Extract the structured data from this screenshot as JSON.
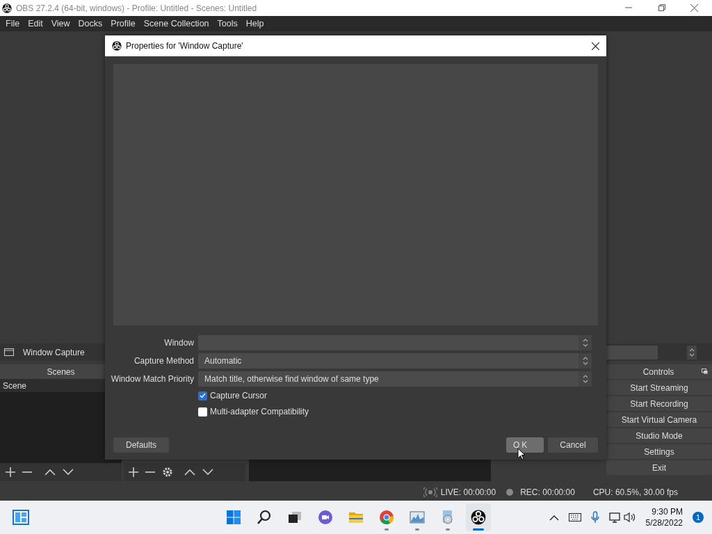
{
  "app": {
    "title": "OBS 27.2.4 (64-bit, windows) - Profile: Untitled - Scenes: Untitled",
    "menu": [
      "File",
      "Edit",
      "View",
      "Docks",
      "Profile",
      "Scene Collection",
      "Tools",
      "Help"
    ]
  },
  "source_bar": {
    "label": "Window Capture"
  },
  "scenes": {
    "title": "Scenes",
    "items": [
      {
        "label": "Scene",
        "selected": true
      }
    ]
  },
  "controls": {
    "title": "Controls",
    "buttons": [
      "Start Streaming",
      "Start Recording",
      "Start Virtual Camera",
      "Studio Mode",
      "Settings",
      "Exit"
    ]
  },
  "status": {
    "live": "LIVE: 00:00:00",
    "rec": "REC: 00:00:00",
    "cpu": "CPU: 60.5%, 30.00 fps"
  },
  "dialog": {
    "title": "Properties for 'Window Capture'",
    "fields": [
      {
        "label": "Window"
      },
      {
        "label": "Capture Method",
        "value": "Automatic"
      },
      {
        "label": "Window Match Priority",
        "value": "Match title, otherwise find window of same type"
      }
    ],
    "checkboxes": [
      {
        "label": "Capture Cursor",
        "checked": true
      },
      {
        "label": "Multi-adapter Compatibility",
        "checked": false
      }
    ],
    "defaults": "Defaults",
    "ok": "OK",
    "cancel": "Cancel"
  },
  "taskbar": {
    "apps": [
      {
        "kind": "start",
        "running": false,
        "active": false
      },
      {
        "kind": "search",
        "running": false,
        "active": false
      },
      {
        "kind": "taskview",
        "running": false,
        "active": false
      },
      {
        "kind": "chat",
        "running": false,
        "active": false
      },
      {
        "kind": "explorer",
        "running": false,
        "active": false
      },
      {
        "kind": "chrome",
        "running": true,
        "active": false
      },
      {
        "kind": "monitor",
        "running": true,
        "active": false
      },
      {
        "kind": "media",
        "running": true,
        "active": false
      },
      {
        "kind": "obs",
        "running": true,
        "active": true
      }
    ],
    "time": "9:30 PM",
    "date": "5/28/2022",
    "badge": "1"
  }
}
